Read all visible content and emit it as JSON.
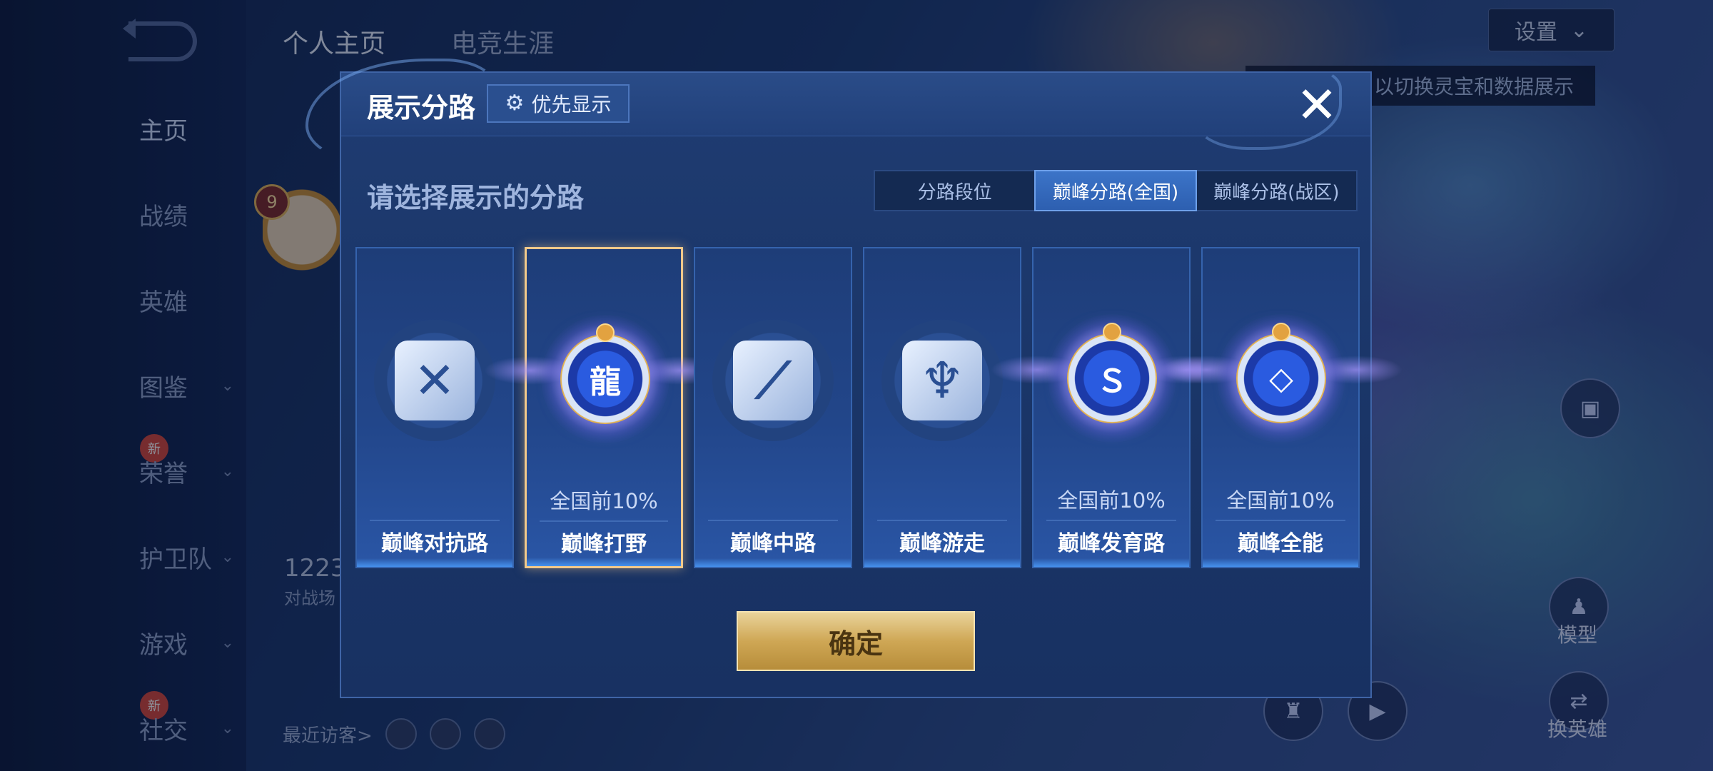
{
  "colors": {
    "accent": "#3c74c8",
    "gold": "#cfa755",
    "panel": "#1f3c72",
    "selected_border": "#f2c98a"
  },
  "nav": {
    "items": [
      {
        "label": "主页",
        "active": true
      },
      {
        "label": "战绩"
      },
      {
        "label": "英雄"
      },
      {
        "label": "图鉴"
      },
      {
        "label": "荣誉",
        "badge": "新"
      },
      {
        "label": "护卫队"
      },
      {
        "label": "游戏"
      },
      {
        "label": "社交",
        "badge": "新"
      }
    ]
  },
  "top_tabs": [
    "个人主页",
    "电竞生涯"
  ],
  "settings_label": "设置",
  "hint_text": "以切换灵宝和数据展示",
  "profile": {
    "level": "9",
    "stat_number": "1223",
    "stat_sub": "对战场",
    "visitors_label": "最近访客>"
  },
  "right_panel": {
    "model_label": "模型",
    "swap_hero_label": "换英雄"
  },
  "dialog": {
    "title": "展示分路",
    "priority_label": "优先显示",
    "close_symbol": "✕",
    "prompt": "请选择展示的分路",
    "tabs": [
      "分路段位",
      "巅峰分路(全国)",
      "巅峰分路(战区)"
    ],
    "active_tab": 1,
    "cards": [
      {
        "name": "巅峰对抗路",
        "rank": "",
        "emblem": "sword-cross-icon",
        "highlighted": false
      },
      {
        "name": "巅峰打野",
        "rank": "全国前10%",
        "emblem": "dragon-icon",
        "highlighted": true
      },
      {
        "name": "巅峰中路",
        "rank": "",
        "emblem": "slash-icon",
        "highlighted": false
      },
      {
        "name": "巅峰游走",
        "rank": "",
        "emblem": "wings-icon",
        "highlighted": false
      },
      {
        "name": "巅峰发育路",
        "rank": "全国前10%",
        "emblem": "target-s-icon",
        "highlighted": true
      },
      {
        "name": "巅峰全能",
        "rank": "全国前10%",
        "emblem": "diamond-icon",
        "highlighted": true
      }
    ],
    "selected_card": 1,
    "confirm_label": "确定"
  }
}
